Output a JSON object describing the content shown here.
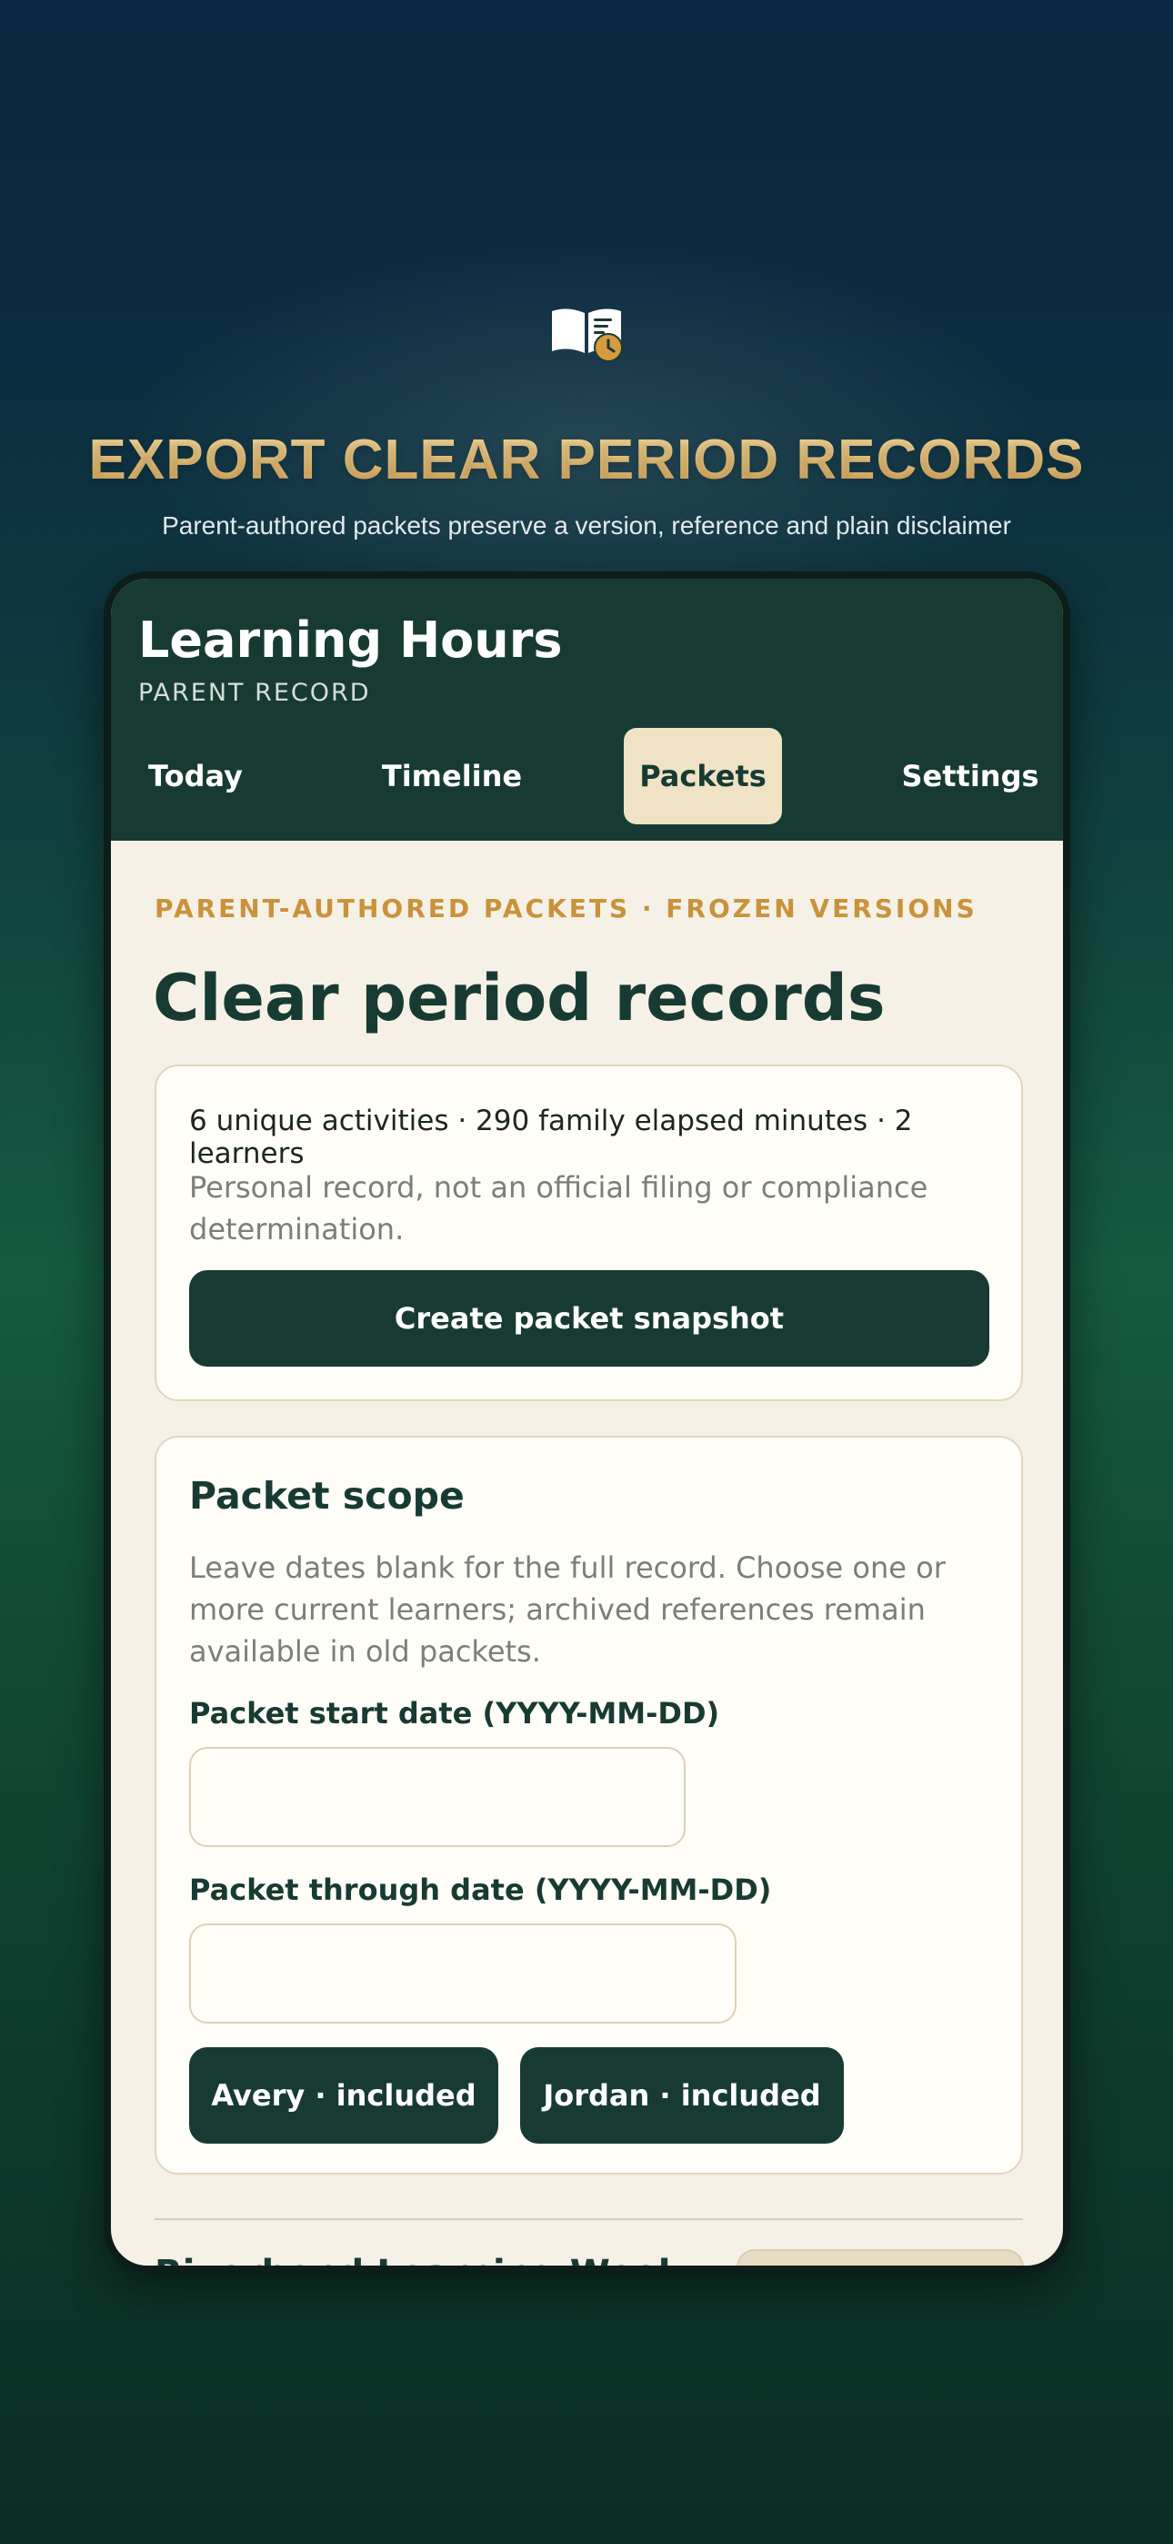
{
  "promo": {
    "headline": "EXPORT CLEAR PERIOD RECORDS",
    "subheadline": "Parent-authored packets preserve a version, reference and plain disclaimer",
    "icon": "book-clock-icon"
  },
  "app": {
    "title": "Learning Hours",
    "subtitle": "PARENT RECORD",
    "tabs": [
      {
        "label": "Today",
        "active": false
      },
      {
        "label": "Timeline",
        "active": false
      },
      {
        "label": "Packets",
        "active": true
      },
      {
        "label": "Settings",
        "active": false
      }
    ]
  },
  "page": {
    "eyebrow": "PARENT-AUTHORED PACKETS · FROZEN VERSIONS",
    "title": "Clear period records"
  },
  "summary_card": {
    "summary": "6 unique activities · 290 family elapsed minutes · 2 learners",
    "disclaimer": "Personal record, not an official filing or compliance determination.",
    "button_label": "Create packet snapshot"
  },
  "scope_card": {
    "title": "Packet scope",
    "help": "Leave dates blank for the full record. Choose one or more current learners; archived references remain available in old packets.",
    "start_label": "Packet start date (YYYY-MM-DD)",
    "start_value": "",
    "through_label": "Packet through date (YYYY-MM-DD)",
    "through_value": "",
    "learners": [
      {
        "label": "Avery · included"
      },
      {
        "label": "Jordan · included"
      }
    ]
  },
  "packet_list": {
    "first_title": "Riverbend Learning Week"
  },
  "colors": {
    "brand_dark": "#173b32",
    "accent_gold": "#c9923b",
    "tab_active_bg": "#efe2c5",
    "paper": "#f6f1e6"
  }
}
